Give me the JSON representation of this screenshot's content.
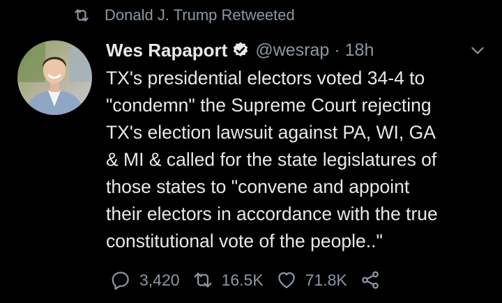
{
  "retweet_context": {
    "icon": "retweet-icon",
    "text": "Donald J. Trump Retweeted"
  },
  "author": {
    "name": "Wes Rapaport",
    "verified": true,
    "handle": "@wesrap",
    "separator": "·",
    "time": "18h"
  },
  "tweet": {
    "text": "TX's presidential electors voted 34-4 to\n\"condemn\" the Supreme Court rejecting\nTX's election lawsuit against PA, WI, GA\n& MI & called for the state legislatures of\nthose states to \"convene and appoint\ntheir electors in accordance with the true\nconstitutional vote of the people..\""
  },
  "actions": {
    "reply_count": "3,420",
    "retweet_count": "16.5K",
    "like_count": "71.8K"
  },
  "colors": {
    "background": "#000000",
    "text_primary": "#e7e9ea",
    "text_secondary": "#8b98a5",
    "verified": "#e7e9ea"
  }
}
